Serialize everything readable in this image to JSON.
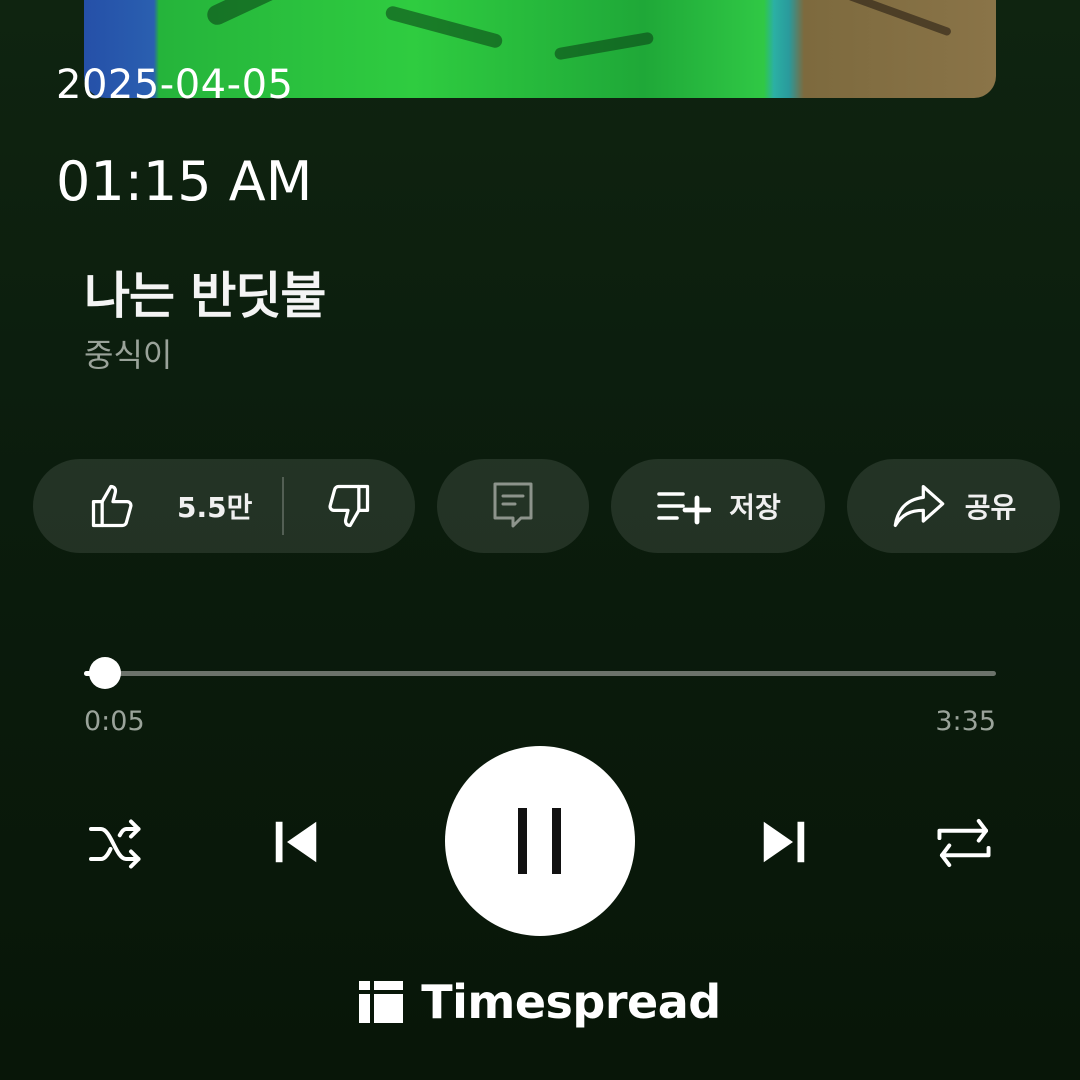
{
  "overlay": {
    "date": "2025-04-05",
    "time": "01:15 AM"
  },
  "song": {
    "title": "나는 반딧불",
    "artist": "중식이"
  },
  "actions": {
    "like_count": "5.5만",
    "save_label": "저장",
    "share_label": "공유"
  },
  "player": {
    "current_time": "0:05",
    "total_time": "3:35",
    "progress_fraction": 0.023,
    "state": "playing"
  },
  "brand": {
    "name": "Timespread"
  },
  "icons": {
    "like": "thumbs-up-icon",
    "dislike": "thumbs-down-icon",
    "comment": "comment-icon",
    "save": "playlist-add-icon",
    "share": "share-icon",
    "shuffle": "shuffle-icon",
    "previous": "skip-previous-icon",
    "pause": "pause-icon",
    "next": "skip-next-icon",
    "repeat": "repeat-icon"
  },
  "colors": {
    "background": "#0b1c0d",
    "pill": "#1f2e20",
    "secondary_text": "#9aa39a",
    "track": "#6c736b"
  }
}
